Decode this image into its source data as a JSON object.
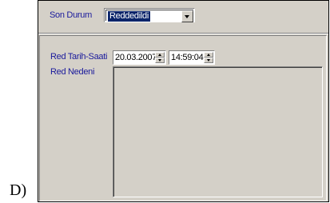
{
  "option_label": "D)",
  "status": {
    "label": "Son Durum",
    "selected_value": "Reddedildi"
  },
  "rejection": {
    "datetime_label": "Red Tarih-Saati",
    "date_value": "20.03.2007",
    "time_value": "14:59:04",
    "reason_label": "Red Nedeni",
    "reason_value": ""
  },
  "colors": {
    "label_text": "#1a1a9c",
    "panel_bg": "#d4d0c8",
    "selection_bg": "#0a246a"
  }
}
